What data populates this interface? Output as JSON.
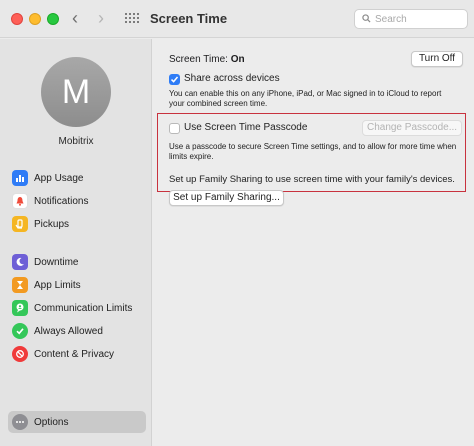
{
  "window": {
    "title": "Screen Time"
  },
  "search": {
    "placeholder": "Search"
  },
  "user": {
    "initial": "M",
    "name": "Mobitrix"
  },
  "sidebar": {
    "items": [
      {
        "label": "App Usage",
        "icon": "bar-chart-icon",
        "color": "#2f7cf6"
      },
      {
        "label": "Notifications",
        "icon": "bell-icon",
        "color": "#f04b3a"
      },
      {
        "label": "Pickups",
        "icon": "pickup-icon",
        "color": "#f5a623"
      },
      {
        "label": "Downtime",
        "icon": "moon-icon",
        "color": "#6e5fd6"
      },
      {
        "label": "App Limits",
        "icon": "hourglass-icon",
        "color": "#f29a22"
      },
      {
        "label": "Communication Limits",
        "icon": "person-bubble-icon",
        "color": "#34c759"
      },
      {
        "label": "Always Allowed",
        "icon": "checkmark-icon",
        "color": "#34c759"
      },
      {
        "label": "Content & Privacy",
        "icon": "no-entry-icon",
        "color": "#f03a3a"
      },
      {
        "label": "Options",
        "icon": "ellipsis-icon",
        "color": "#8e8e93",
        "selected": true
      }
    ]
  },
  "main": {
    "status_label": "Screen Time:",
    "status_value": "On",
    "turn_off": "Turn Off",
    "share": {
      "label": "Share across devices",
      "checked": true,
      "description": "You can enable this on any iPhone, iPad, or Mac signed in to iCloud to report your combined screen time."
    },
    "passcode": {
      "label": "Use Screen Time Passcode",
      "checked": false,
      "button": "Change Passcode...",
      "description": "Use a passcode to secure Screen Time settings, and to allow for more time when limits expire."
    },
    "family_text": "Set up Family Sharing to use screen time with your family's devices.",
    "family_button": "Set up Family Sharing...",
    "highlight_color": "#c8323e"
  }
}
